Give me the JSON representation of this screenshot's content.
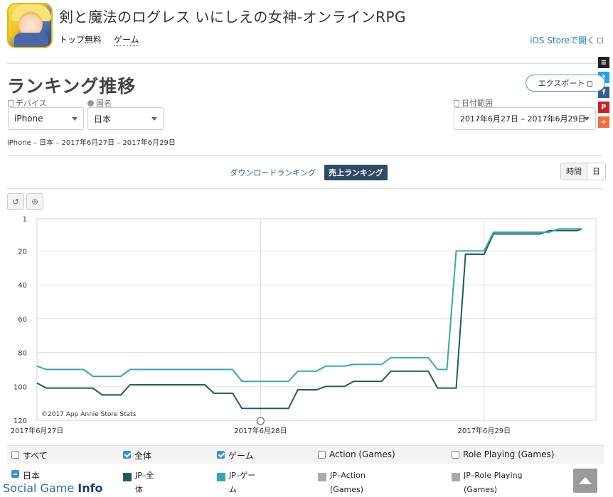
{
  "app": {
    "title": "剣と魔法のログレス いにしえの女神-オンラインRPG",
    "free_label": "トップ無料",
    "genre_label": "ゲーム",
    "store_link": "iOS Storeで開く"
  },
  "section": {
    "title": "ランキング推移",
    "export_label": "エクスポート"
  },
  "filters": {
    "device_label": "デバイス",
    "device_value": "iPhone",
    "country_label": "国名",
    "country_value": "日本",
    "date_label": "日付範囲",
    "date_value": "2017年6月27日 – 2017年6月29日"
  },
  "summary": "iPhone – 日本 – 2017年6月27日 – 2017年6月29日",
  "ranking_tabs": [
    {
      "label": "ダウンロードランキング",
      "active": false
    },
    {
      "label": "売上ランキング",
      "active": true
    }
  ],
  "granularity": {
    "hour": "時間",
    "day": "日"
  },
  "chart_data": {
    "type": "line",
    "copyright": "©2017 App Annie Store Stats",
    "y_inverted": true,
    "ylim": [
      1,
      120
    ],
    "yticks": [
      1,
      20,
      40,
      60,
      80,
      100,
      120
    ],
    "x_range": [
      0,
      60
    ],
    "x_ticks": [
      {
        "x": 0,
        "label": "2017年6月27日"
      },
      {
        "x": 24,
        "label": "2017年6月28日"
      },
      {
        "x": 48,
        "label": "2017年6月29日"
      }
    ],
    "series": [
      {
        "name": "JP-全体",
        "color": "#1f5c5e",
        "points": [
          [
            0,
            98
          ],
          [
            1,
            101
          ],
          [
            6,
            101
          ],
          [
            7,
            105
          ],
          [
            9,
            105
          ],
          [
            10,
            99
          ],
          [
            18,
            99
          ],
          [
            19,
            104
          ],
          [
            21,
            104
          ],
          [
            22,
            113
          ],
          [
            27,
            113
          ],
          [
            28,
            102
          ],
          [
            30,
            102
          ],
          [
            31,
            100
          ],
          [
            33,
            100
          ],
          [
            34,
            97
          ],
          [
            37,
            97
          ],
          [
            38,
            91
          ],
          [
            42,
            91
          ],
          [
            43,
            101
          ],
          [
            45,
            101
          ],
          [
            46,
            22
          ],
          [
            48,
            22
          ],
          [
            49,
            10
          ],
          [
            54,
            10
          ],
          [
            55,
            8
          ],
          [
            58,
            8
          ],
          [
            58.5,
            7
          ]
        ]
      },
      {
        "name": "JP-ゲーム",
        "color": "#34a8b0",
        "points": [
          [
            0,
            88
          ],
          [
            1,
            90
          ],
          [
            5,
            90
          ],
          [
            6,
            94
          ],
          [
            9,
            94
          ],
          [
            10,
            90
          ],
          [
            21,
            90
          ],
          [
            22,
            97
          ],
          [
            27,
            97
          ],
          [
            28,
            91
          ],
          [
            30,
            91
          ],
          [
            31,
            88
          ],
          [
            33,
            88
          ],
          [
            34,
            87
          ],
          [
            37,
            87
          ],
          [
            38,
            83
          ],
          [
            42,
            83
          ],
          [
            43,
            90
          ],
          [
            44,
            90
          ],
          [
            45,
            20
          ],
          [
            48,
            20
          ],
          [
            49,
            9
          ],
          [
            55,
            9
          ],
          [
            56,
            7
          ],
          [
            58.5,
            7
          ]
        ]
      }
    ]
  },
  "legend": {
    "row1": [
      {
        "label": "すべて",
        "checked": false
      },
      {
        "label": "全体",
        "checked": true
      },
      {
        "label": "ゲーム",
        "checked": true
      },
      {
        "label": "Action (Games)",
        "checked": false
      },
      {
        "label": "Role Playing (Games)",
        "checked": false
      }
    ],
    "row2": [
      {
        "label": "日本"
      },
      {
        "label": "JP–全\n体",
        "color": "#1f5c5e"
      },
      {
        "label": "JP–ゲー\nム",
        "color": "#34a8b0"
      },
      {
        "label": "JP–Action\n(Games)",
        "color": "#aaaaaa"
      },
      {
        "label": "JP–Role Playing\n(Games)",
        "color": "#aaaaaa"
      }
    ]
  },
  "watermark": {
    "prefix": "Social Game ",
    "bold": "Info"
  },
  "social": [
    {
      "glyph": "≡",
      "color": "#222222"
    },
    {
      "glyph": "t",
      "color": "#1da1f2"
    },
    {
      "glyph": "f",
      "color": "#3b5998"
    },
    {
      "glyph": "P",
      "color": "#cb2027"
    },
    {
      "glyph": "+",
      "color": "#f26b3a"
    }
  ]
}
